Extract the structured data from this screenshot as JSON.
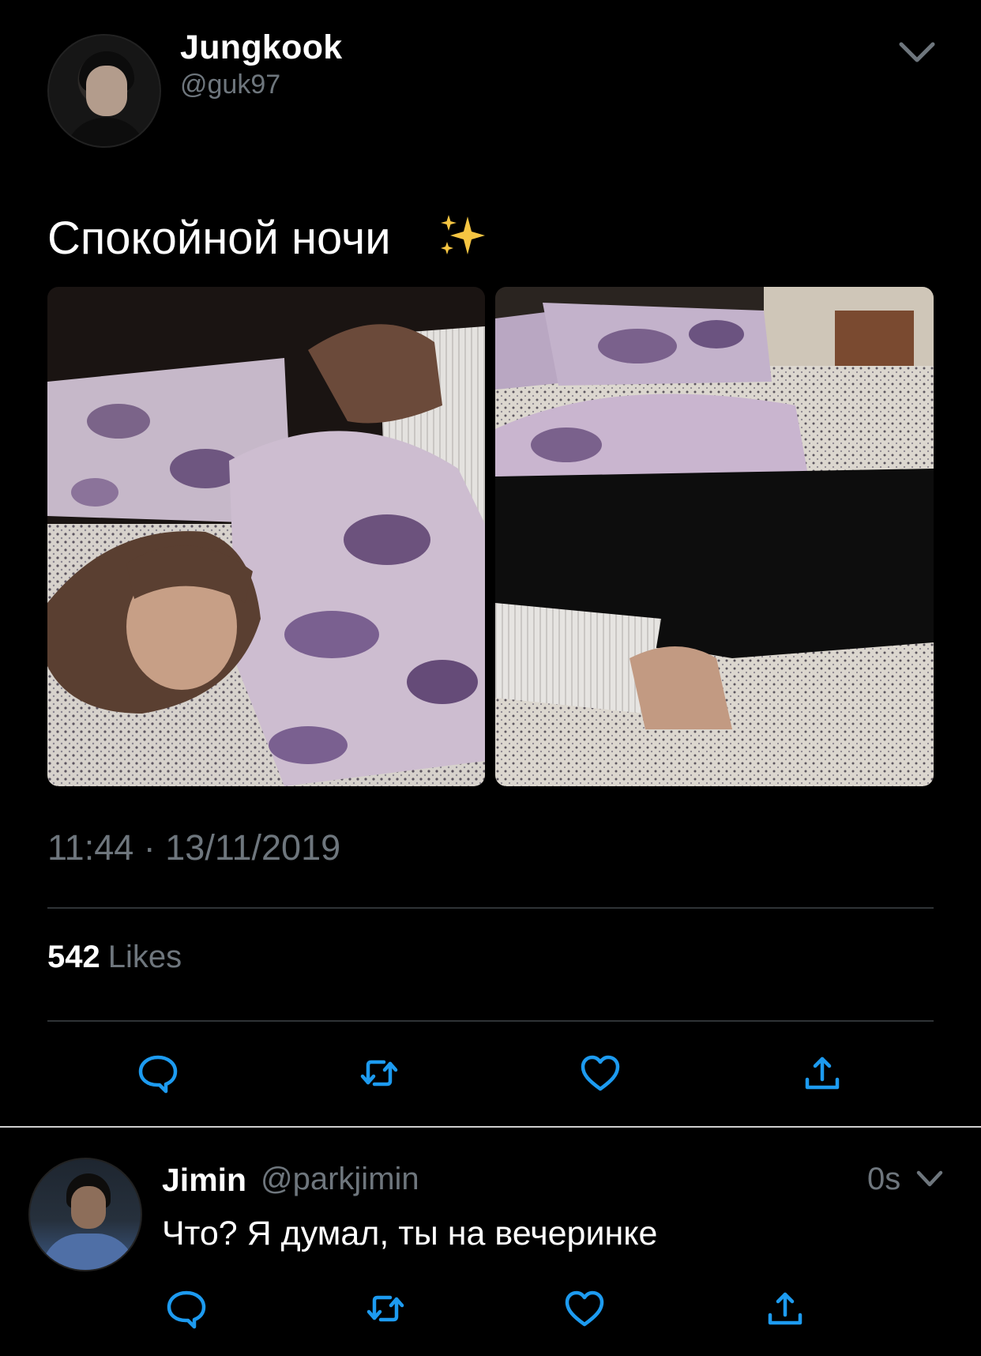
{
  "tweet": {
    "author_name": "Jungkook",
    "author_handle": "@guk97",
    "text": "Спокойной ночи",
    "emoji_icon": "sparkles-icon",
    "time": "11:44 · 13/11/2019",
    "likes_count": "542",
    "likes_label": "Likes"
  },
  "reply": {
    "author_name": "Jimin",
    "author_handle": "@parkjimin",
    "time": "0s",
    "text": "Что? Я думал, ты на вечеринке"
  },
  "actions": [
    "reply-icon",
    "retweet-icon",
    "like-icon",
    "share-icon"
  ],
  "colors": {
    "background": "#000000",
    "text_primary": "#ffffff",
    "text_secondary": "#6e767d",
    "divider": "#2f3336",
    "sparkle": "#f5c542"
  }
}
